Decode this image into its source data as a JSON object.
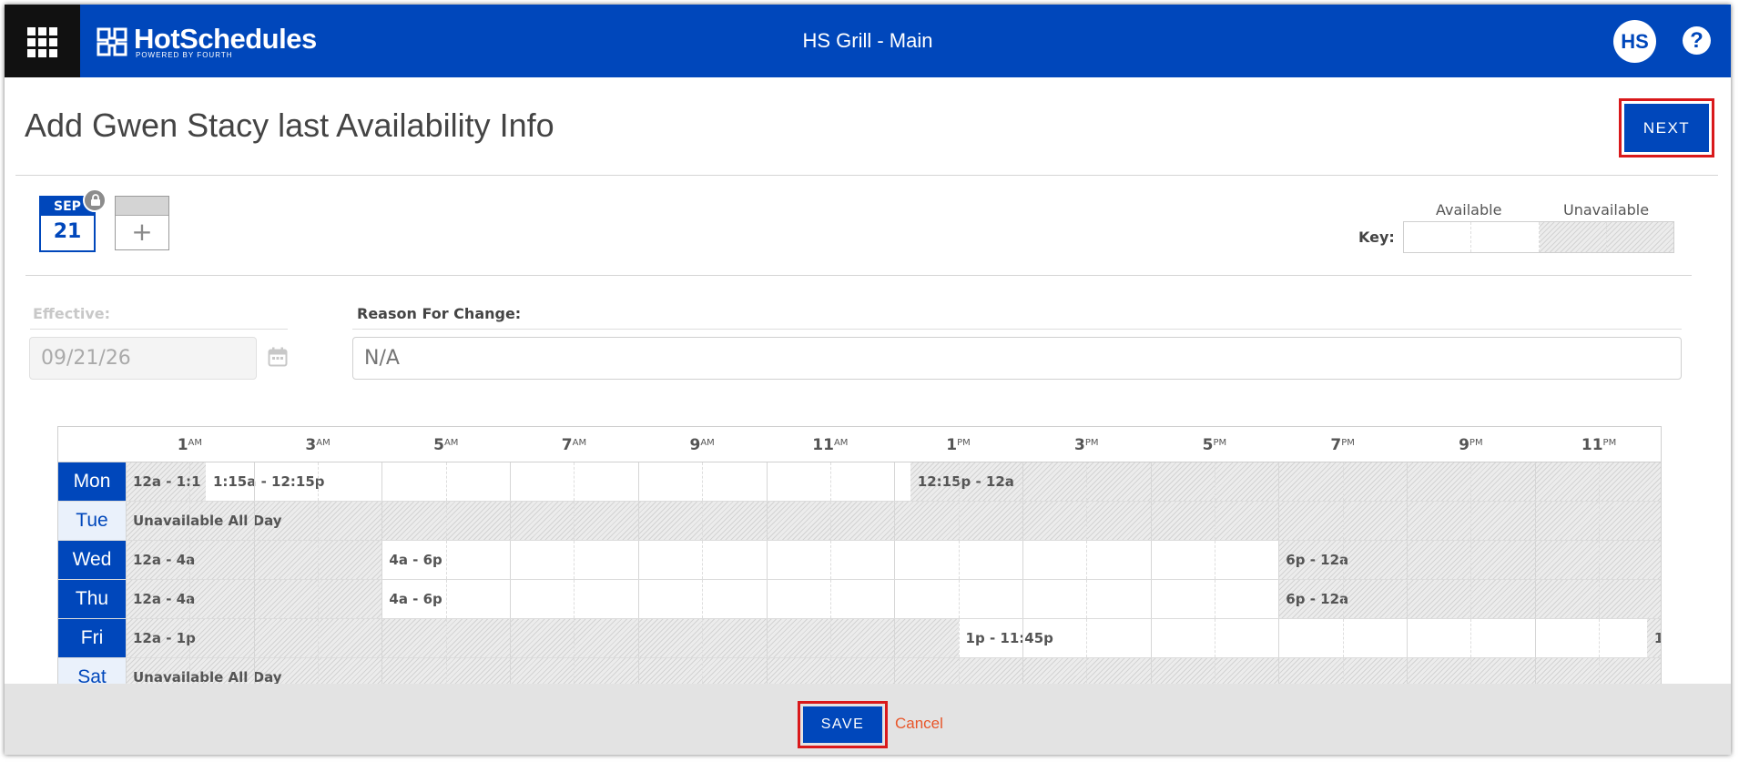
{
  "header": {
    "brand_name": "HotSchedules",
    "brand_tagline": "POWERED BY FOURTH",
    "location": "HS Grill - Main",
    "avatar_initials": "HS",
    "help_symbol": "?"
  },
  "page": {
    "title": "Add Gwen Stacy last Availability Info",
    "next_label": "NEXT"
  },
  "calendar_tile": {
    "month": "SEP",
    "day": "21",
    "locked_icon": "lock-icon"
  },
  "add_tile": {
    "symbol": "+"
  },
  "key": {
    "title": "Key:",
    "available": "Available",
    "unavailable": "Unavailable"
  },
  "form": {
    "effective_label": "Effective:",
    "effective_value": "09/21/26",
    "reason_label": "Reason For Change:",
    "reason_placeholder": "N/A"
  },
  "schedule": {
    "hour_labels": [
      {
        "num": "1",
        "ampm": "AM"
      },
      {
        "num": "3",
        "ampm": "AM"
      },
      {
        "num": "5",
        "ampm": "AM"
      },
      {
        "num": "7",
        "ampm": "AM"
      },
      {
        "num": "9",
        "ampm": "AM"
      },
      {
        "num": "11",
        "ampm": "AM"
      },
      {
        "num": "1",
        "ampm": "PM"
      },
      {
        "num": "3",
        "ampm": "PM"
      },
      {
        "num": "5",
        "ampm": "PM"
      },
      {
        "num": "7",
        "ampm": "PM"
      },
      {
        "num": "9",
        "ampm": "PM"
      },
      {
        "num": "11",
        "ampm": "PM"
      }
    ],
    "days": [
      {
        "label": "Mon",
        "style": "dark",
        "segments": [
          {
            "start": 0,
            "end": 1.25,
            "available": false,
            "text": "12a - 1:1"
          },
          {
            "start": 1.25,
            "end": 12.25,
            "available": true,
            "text": "1:15a - 12:15p"
          },
          {
            "start": 12.25,
            "end": 24,
            "available": false,
            "text": "12:15p - 12a"
          }
        ]
      },
      {
        "label": "Tue",
        "style": "light",
        "segments": [
          {
            "start": 0,
            "end": 24,
            "available": false,
            "text": "Unavailable All Day"
          }
        ]
      },
      {
        "label": "Wed",
        "style": "dark",
        "segments": [
          {
            "start": 0,
            "end": 4,
            "available": false,
            "text": "12a - 4a"
          },
          {
            "start": 4,
            "end": 18,
            "available": true,
            "text": "4a - 6p"
          },
          {
            "start": 18,
            "end": 24,
            "available": false,
            "text": "6p - 12a"
          }
        ]
      },
      {
        "label": "Thu",
        "style": "dark",
        "segments": [
          {
            "start": 0,
            "end": 4,
            "available": false,
            "text": "12a - 4a"
          },
          {
            "start": 4,
            "end": 18,
            "available": true,
            "text": "4a - 6p"
          },
          {
            "start": 18,
            "end": 24,
            "available": false,
            "text": "6p - 12a"
          }
        ]
      },
      {
        "label": "Fri",
        "style": "dark",
        "segments": [
          {
            "start": 0,
            "end": 13,
            "available": false,
            "text": "12a - 1p"
          },
          {
            "start": 13,
            "end": 23.75,
            "available": true,
            "text": "1p - 11:45p"
          },
          {
            "start": 23.75,
            "end": 24,
            "available": false,
            "text": "1"
          }
        ]
      },
      {
        "label": "Sat",
        "style": "light",
        "segments": [
          {
            "start": 0,
            "end": 24,
            "available": false,
            "text": "Unavailable All Day"
          }
        ]
      }
    ]
  },
  "footer": {
    "save_label": "SAVE",
    "cancel_label": "Cancel"
  },
  "colors": {
    "brand_blue": "#0047bb",
    "highlight_red": "#d9191b",
    "cancel_orange": "#e8562a"
  }
}
